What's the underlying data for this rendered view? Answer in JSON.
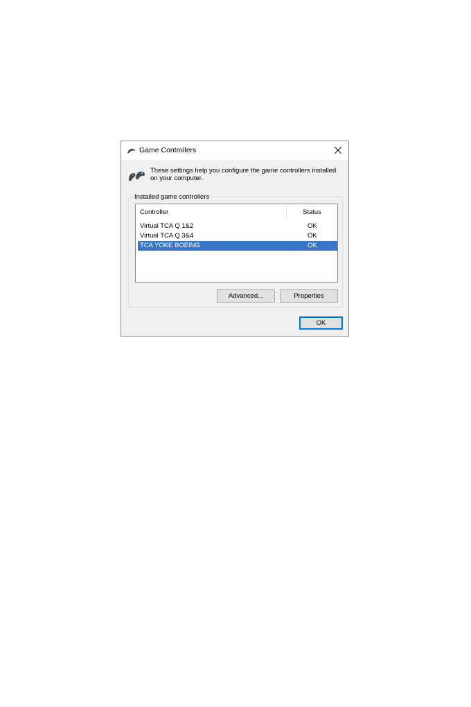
{
  "window": {
    "title": "Game Controllers",
    "title_icon": "joystick-icon",
    "close_icon": "close-icon"
  },
  "info": {
    "icon": "gamepad-icon",
    "text": "These settings help you configure the game controllers installed on your computer."
  },
  "group": {
    "label": "Installed game controllers"
  },
  "list": {
    "headers": {
      "controller": "Controller",
      "status": "Status"
    },
    "rows": [
      {
        "controller": "Virtual TCA Q 1&2",
        "status": "OK",
        "selected": false
      },
      {
        "controller": "Virtual TCA Q 3&4",
        "status": "OK",
        "selected": false
      },
      {
        "controller": "TCA YOKE BOEING",
        "status": "OK",
        "selected": true
      }
    ]
  },
  "buttons": {
    "advanced": "Advanced...",
    "properties": "Properties",
    "ok": "OK"
  },
  "colors": {
    "selection": "#3874c8",
    "default_button_border": "#0078d7",
    "dialog_background": "#f0f0f0"
  }
}
